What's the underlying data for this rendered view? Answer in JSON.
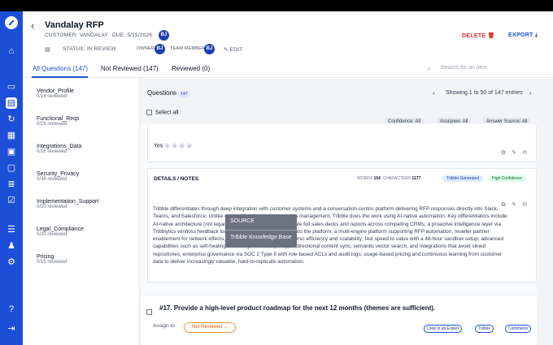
{
  "app": {
    "title": "Vandalay RFP"
  },
  "meta": {
    "customer": "CUSTOMER: VANDALAY",
    "due": "DUE: 5/15/2026",
    "status": "STATUS: IN REVIEW",
    "owner_label": "OWNER",
    "owner_initials": "BJ",
    "team_label": "TEAM MEMBERS",
    "team_initials": "BJ",
    "edit_label": "EDIT",
    "header_avatar": "BJ"
  },
  "actions": {
    "delete": "DELETE",
    "export": "EXPORT"
  },
  "tabs": [
    {
      "label": "All Questions (147)"
    },
    {
      "label": "Not Reviewed (147)"
    },
    {
      "label": "Reviewed (0)"
    }
  ],
  "search": {
    "placeholder": "Search for an item"
  },
  "sections": [
    {
      "name": "Vendor_Profile",
      "sub": "0/14 reviewed"
    },
    {
      "name": "Functional_Reqs",
      "sub": "0/26 reviewed"
    },
    {
      "name": "Integrations_Data",
      "sub": "0/16 reviewed"
    },
    {
      "name": "Security_Privacy",
      "sub": "0/36 reviewed"
    },
    {
      "name": "Implementation_Support",
      "sub": "0/20 reviewed"
    },
    {
      "name": "Legal_Compliance",
      "sub": "0/20 reviewed"
    },
    {
      "name": "Pricing",
      "sub": "0/15 reviewed"
    }
  ],
  "questions": {
    "label": "Questions",
    "count": "147",
    "pagination": "Showing 1 to 50 of 147 entries",
    "select_all": "Select all",
    "filters": {
      "confidence": "Confidence: All",
      "assignee": "Assignee: All",
      "source": "Answer Source: All"
    }
  },
  "response_card": {
    "answer": "Yes",
    "refs": [
      "1",
      "2",
      "3",
      "4"
    ]
  },
  "notes_card": {
    "title": "DETAILS / NOTES",
    "words_label": "WORDS",
    "words": "154",
    "chars_label": "CHARACTERS",
    "chars": "1177",
    "generated": "Tribble Generated",
    "confidence": "High Confidence",
    "text": "Tribble differentiates through deep integration with customer systems and a conversation-centric platform delivering RFP responses directly into Slack, Teams, and Salesforce. Unlike competitors focused on process management, Tribble does the work using AI-native automation. Key differentiators include AI-native architecture (not legacy AI retrofitted) that can generate full sales decks and reports across competing CRMs; a proactive intelligence layer via Tribblytics win/loss feedback loop that surfaces insights back into the platform; a multi-engine platform supporting RFP automation, reseller partner enablement for network effects; usage-based pricing for economic efficiency and scalability; fast speed to value with a 48-hour sandbox setup; advanced capabilities such as self-healing knowledge for data quality, bi-directional content sync, semantic vector search, and integrations that avoid siloed repositories; enterprise governance via SOC 2 Type II with role-based ACLs and audit logs; usage-based pricing and continuous learning from customer data to deliver increasingly valuable, hard-to-replicate automation."
  },
  "tooltip": {
    "label": "SOURCE",
    "value": "Tribble Knowledge Base"
  },
  "q17": {
    "text": "#17. Provide a high-level product roadmap for the next 12 months (themes are sufficient).",
    "assign": "Assign to",
    "status": "Not Reviewed",
    "chips": [
      "Loop in an Expert",
      "Tribble",
      "Comments"
    ]
  }
}
